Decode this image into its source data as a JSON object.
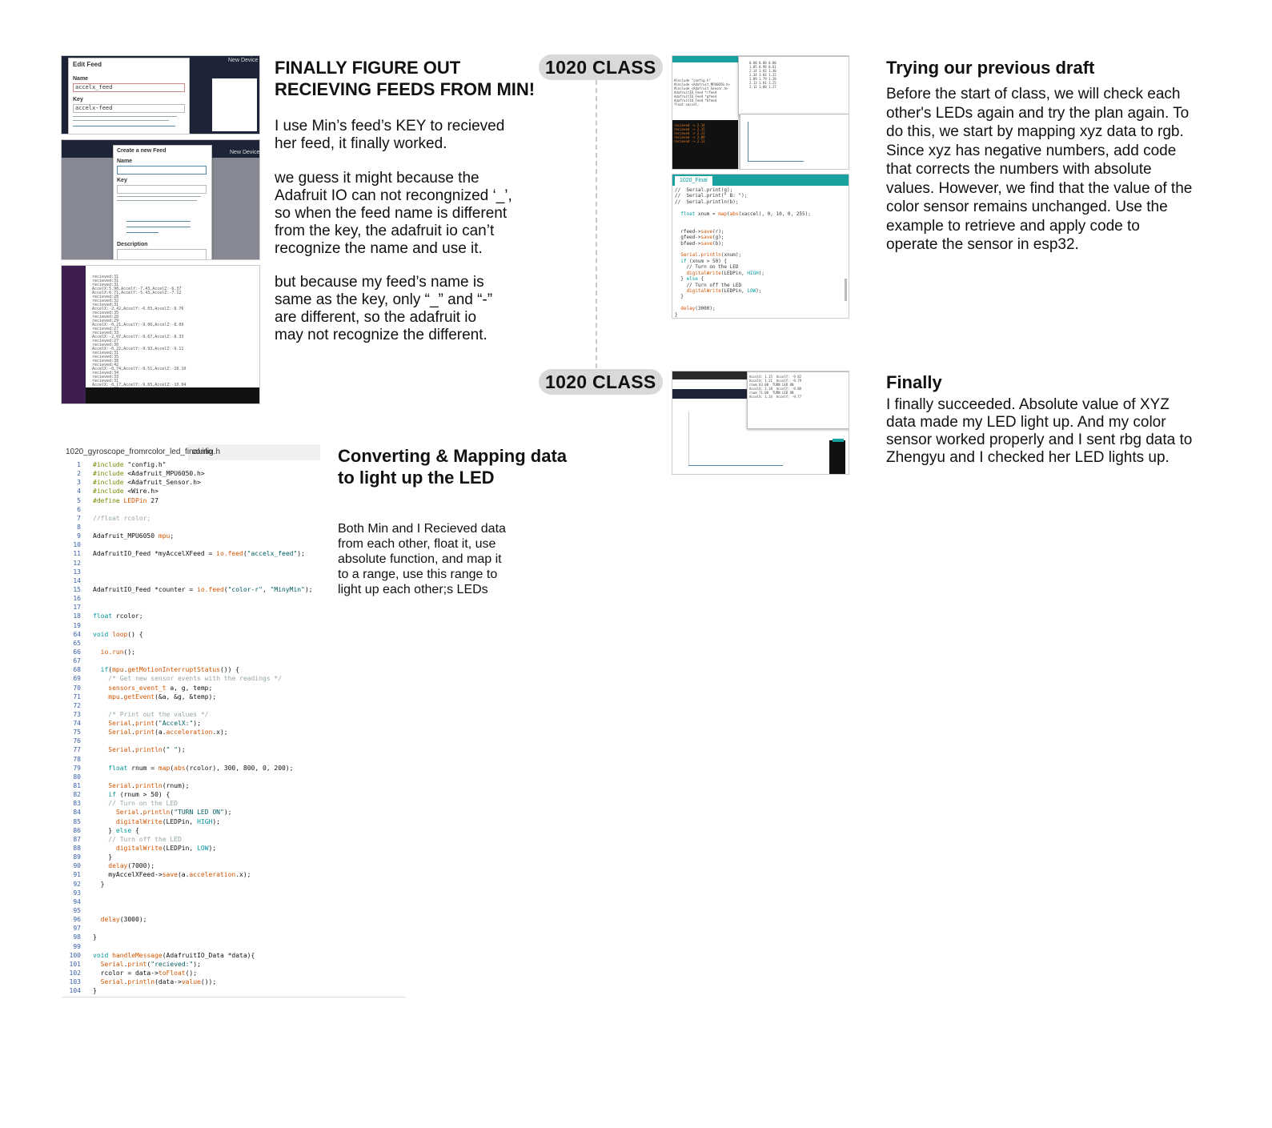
{
  "col1": {
    "heading": "FINALLY FIGURE OUT\nRECIEVING FEEDS FROM MIN!",
    "para1": "I use Min’s feed’s KEY to recieved\nher feed, it finally worked.",
    "para2": "we guess it might because the\nAdafruit IO can not recongnized ‘_’,\nso when the feed name is different\nfrom the key, the adafruit io can’t\nrecognize the name and use it.",
    "para3": "but because my feed’s name is\nsame as the key, only “_” and “-”\nare different, so the adafruit io\nmay not recognize the different."
  },
  "shots": {
    "edit_feed": {
      "title": "Edit Feed",
      "name_label": "Name",
      "name_value": "accelx_feed",
      "key_label": "Key",
      "key_value": "accelx-feed",
      "button": "New Device"
    },
    "create_feed": {
      "title": "Create a new Feed",
      "name_label": "Name",
      "key_label": "Key",
      "desc_label": "Description",
      "button": "New Device"
    },
    "code_final": {
      "tab": "1020_Final"
    }
  },
  "timeline": {
    "label1": "1020 CLASS",
    "label2": "1020 CLASS"
  },
  "col3": {
    "heading1": "Trying our previous draft",
    "para1": "Before the start of class, we will check each\nother's LEDs again and try the plan again. To\ndo this, we start by mapping xyz data to rgb.\nSince xyz has negative numbers, add code\nthat corrects the numbers with absolute\nvalues. However, we find that the value of the\ncolor sensor remains unchanged. Use the\nexample to retrieve and apply code to\noperate the sensor in esp32.",
    "heading2": "Finally",
    "para2": "I finally succeeded. Absolute value of XYZ\ndata made my LED light up. And my color\nsensor worked properly and I sent rbg data to\nZhengyu and I checked her LED lights up."
  },
  "col2": {
    "heading": "Converting & Mapping data\nto light up the LED",
    "para": "Both Min and I Recieved data\nfrom each other, float it, use\nabsolute function, and map it\nto a range, use this range to\nlight up each other;s LEDs"
  },
  "code": {
    "tab_active": "1020_gyroscope_fromrcolor_led_final.ino",
    "tab_other": "config.h",
    "lines": [
      {
        "n": "1",
        "t": "#include \"config.h\""
      },
      {
        "n": "2",
        "t": "#include <Adafruit_MPU6050.h>"
      },
      {
        "n": "3",
        "t": "#include <Adafruit_Sensor.h>"
      },
      {
        "n": "4",
        "t": "#include <Wire.h>"
      },
      {
        "n": "5",
        "t": "#define LEDPin 27"
      },
      {
        "n": "6",
        "t": ""
      },
      {
        "n": "7",
        "t": "//float rcolor;"
      },
      {
        "n": "8",
        "t": ""
      },
      {
        "n": "9",
        "t": "Adafruit_MPU6050 mpu;"
      },
      {
        "n": "10",
        "t": ""
      },
      {
        "n": "11",
        "t": "AdafruitIO_Feed *myAccelXFeed = io.feed(\"accelx_feed\");"
      },
      {
        "n": "12",
        "t": ""
      },
      {
        "n": "13",
        "t": ""
      },
      {
        "n": "14",
        "t": ""
      },
      {
        "n": "15",
        "t": "AdafruitIO_Feed *counter = io.feed(\"color-r\", \"MinyMin\");"
      },
      {
        "n": "16",
        "t": ""
      },
      {
        "n": "17",
        "t": ""
      },
      {
        "n": "18",
        "t": "float rcolor;"
      },
      {
        "n": "19",
        "t": ""
      },
      {
        "n": "64",
        "t": "void loop() {"
      },
      {
        "n": "65",
        "t": ""
      },
      {
        "n": "66",
        "t": "  io.run();"
      },
      {
        "n": "67",
        "t": ""
      },
      {
        "n": "68",
        "t": "  if(mpu.getMotionInterruptStatus()) {"
      },
      {
        "n": "69",
        "t": "    /* Get new sensor events with the readings */"
      },
      {
        "n": "70",
        "t": "    sensors_event_t a, g, temp;"
      },
      {
        "n": "71",
        "t": "    mpu.getEvent(&a, &g, &temp);"
      },
      {
        "n": "72",
        "t": ""
      },
      {
        "n": "73",
        "t": "    /* Print out the values */"
      },
      {
        "n": "74",
        "t": "    Serial.print(\"AccelX:\");"
      },
      {
        "n": "75",
        "t": "    Serial.print(a.acceleration.x);"
      },
      {
        "n": "76",
        "t": ""
      },
      {
        "n": "77",
        "t": "    Serial.println(\" \");"
      },
      {
        "n": "78",
        "t": ""
      },
      {
        "n": "79",
        "t": "    float rnum = map(abs(rcolor), 300, 800, 0, 200);"
      },
      {
        "n": "80",
        "t": ""
      },
      {
        "n": "81",
        "t": "    Serial.println(rnum);"
      },
      {
        "n": "82",
        "t": "    if (rnum > 50) {"
      },
      {
        "n": "83",
        "t": "    // Turn on the LED"
      },
      {
        "n": "84",
        "t": "      Serial.println(\"TURN LED ON\");"
      },
      {
        "n": "85",
        "t": "      digitalWrite(LEDPin, HIGH);"
      },
      {
        "n": "86",
        "t": "    } else {"
      },
      {
        "n": "87",
        "t": "    // Turn off the LED"
      },
      {
        "n": "88",
        "t": "      digitalWrite(LEDPin, LOW);"
      },
      {
        "n": "89",
        "t": "    }"
      },
      {
        "n": "90",
        "t": "    delay(7000);"
      },
      {
        "n": "91",
        "t": "    myAccelXFeed->save(a.acceleration.x);"
      },
      {
        "n": "92",
        "t": "  }"
      },
      {
        "n": "93",
        "t": ""
      },
      {
        "n": "94",
        "t": ""
      },
      {
        "n": "95",
        "t": ""
      },
      {
        "n": "96",
        "t": "  delay(3000);"
      },
      {
        "n": "97",
        "t": ""
      },
      {
        "n": "98",
        "t": "}"
      },
      {
        "n": "99",
        "t": ""
      },
      {
        "n": "100",
        "t": "void handleMessage(AdafruitIO_Data *data){"
      },
      {
        "n": "101",
        "t": "  Serial.print(\"recieved:\");"
      },
      {
        "n": "102",
        "t": "  rcolor = data->toFloat();"
      },
      {
        "n": "103",
        "t": "  Serial.println(data->value());"
      },
      {
        "n": "104",
        "t": "}"
      }
    ]
  },
  "colors": {
    "pill_bg": "#d9d9d9",
    "arduino_teal": "#17a2a0",
    "adafruit_dark": "#1d2437"
  }
}
